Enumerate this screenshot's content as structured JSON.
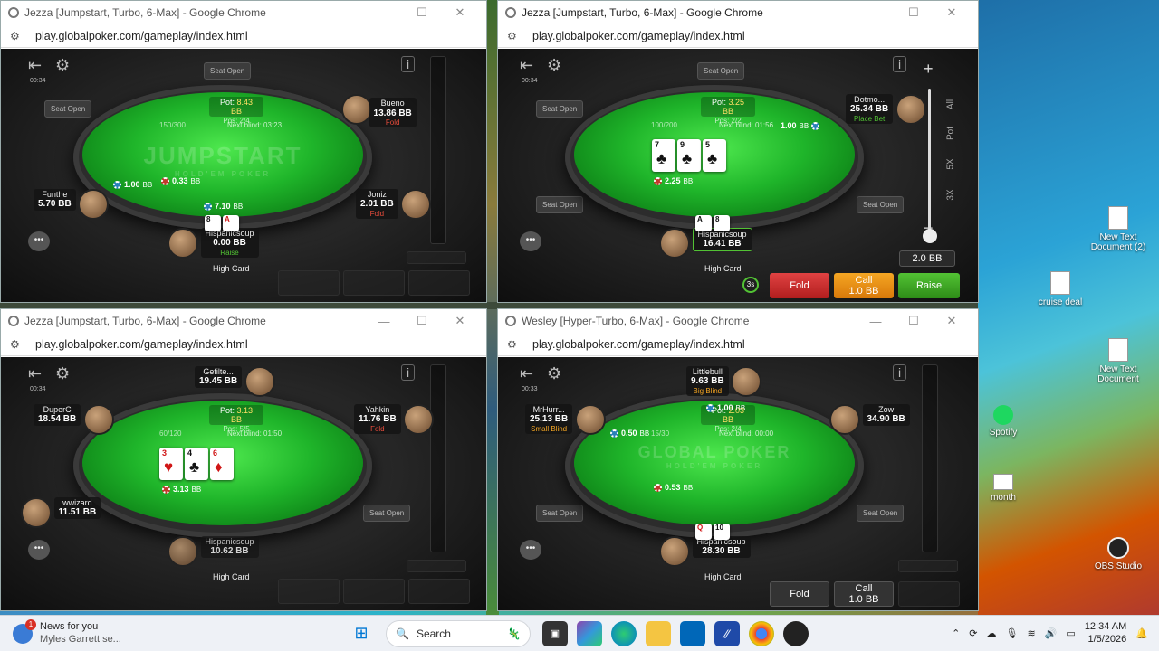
{
  "windows": [
    {
      "title": "Jezza [Jumpstart, Turbo, 6-Max] - Google Chrome",
      "url": "play.globalpoker.com/gameplay/index.html",
      "timer": "00:34",
      "pot_label": "Pot:",
      "pot": "8.43 BB",
      "pos": "Pos: 2/4",
      "blinds": "150/300",
      "next_blind": "Next blind: 03:23",
      "logo": "JUMPSTART",
      "logo_sub": "HOLD'EM POKER",
      "seat_open": "Seat Open",
      "players": [
        {
          "name": "Bueno",
          "stack": "13.86 BB",
          "action": "Fold"
        },
        {
          "name": "Funthe",
          "stack": "5.70 BB",
          "action": ""
        },
        {
          "name": "Joniz",
          "stack": "2.01 BB",
          "action": "Fold"
        },
        {
          "name": "Hispanicsoup",
          "stack": "0.00 BB",
          "action": "Raise"
        }
      ],
      "bets": [
        "1.00",
        "0.33",
        "7.10"
      ],
      "bb": "BB",
      "hole": [
        "8",
        "A"
      ],
      "hand": "High Card"
    },
    {
      "title": "Jezza [Jumpstart, Turbo, 6-Max] - Google Chrome",
      "url": "play.globalpoker.com/gameplay/index.html",
      "timer": "00:34",
      "pot_label": "Pot:",
      "pot": "3.25 BB",
      "pos": "Pos: 2/2",
      "blinds": "100/200",
      "next_blind": "Next blind: 01:56",
      "seat_open": "Seat Open",
      "players": [
        {
          "name": "Dotmo...",
          "stack": "25.34 BB",
          "action": "Place Bet"
        },
        {
          "name": "Hispanicsoup",
          "stack": "16.41 BB",
          "action": ""
        }
      ],
      "bets": [
        "1.00",
        "2.25"
      ],
      "bb": "BB",
      "board": [
        {
          "rank": "7",
          "suit": "♣"
        },
        {
          "rank": "9",
          "suit": "♣"
        },
        {
          "rank": "5",
          "suit": "♣"
        }
      ],
      "hole": [
        "A",
        "8"
      ],
      "hand": "High Card",
      "countdown": "3s",
      "fold": "Fold",
      "call": "Call",
      "call_amount": "1.0 BB",
      "raise": "Raise",
      "raise_value": "2.0 BB",
      "plus": "+",
      "minus": "−",
      "presets": [
        "All",
        "Pot",
        "5X",
        "3X"
      ]
    },
    {
      "title": "Jezza [Jumpstart, Turbo, 6-Max] - Google Chrome",
      "url": "play.globalpoker.com/gameplay/index.html",
      "timer": "00:34",
      "pot_label": "Pot:",
      "pot": "3.13 BB",
      "pos": "Pos: 5/5",
      "blinds": "60/120",
      "next_blind": "Next blind: 01:50",
      "seat_open": "Seat Open",
      "players": [
        {
          "name": "Gefilte...",
          "stack": "19.45 BB",
          "action": ""
        },
        {
          "name": "DuperC",
          "stack": "18.54 BB",
          "action": ""
        },
        {
          "name": "Yahkin",
          "stack": "11.76 BB",
          "action": "Fold"
        },
        {
          "name": "wwizard",
          "stack": "11.51 BB",
          "action": ""
        },
        {
          "name": "Hispanicsoup",
          "stack": "10.62 BB",
          "action": ""
        }
      ],
      "bets": [
        "3.13"
      ],
      "bb": "BB",
      "board": [
        {
          "rank": "3",
          "suit": "♥"
        },
        {
          "rank": "4",
          "suit": "♣"
        },
        {
          "rank": "6",
          "suit": "♦"
        }
      ],
      "hand": "High Card"
    },
    {
      "title": "Wesley [Hyper-Turbo, 6-Max] - Google Chrome",
      "url": "play.globalpoker.com/gameplay/index.html",
      "timer": "00:33",
      "pot_label": "Pot:",
      "pot": "2.03 BB",
      "pos": "Pos: 2/4",
      "blinds": "15/30",
      "next_blind": "Next blind: 00:00",
      "logo": "GLOBAL POKER",
      "logo_sub": "HOLD'EM POKER",
      "seat_open": "Seat Open",
      "players": [
        {
          "name": "Littlebull",
          "stack": "9.63 BB",
          "action": "Big Blind"
        },
        {
          "name": "MrHurr...",
          "stack": "25.13 BB",
          "action": "Small Blind"
        },
        {
          "name": "Zow",
          "stack": "34.90 BB",
          "action": ""
        },
        {
          "name": "Hispanicsoup",
          "stack": "28.30 BB",
          "action": ""
        }
      ],
      "bets": [
        "1.00",
        "0.50",
        "0.53"
      ],
      "bb": "BB",
      "hole": [
        "Q",
        "10"
      ],
      "hand": "High Card",
      "fold": "Fold",
      "call": "Call",
      "call_amount": "1.0 BB"
    }
  ],
  "desktop": {
    "icons": [
      "New Text Document (2)",
      "cruise deal",
      "New Text Document",
      "Spotify",
      "month",
      "OBS Studio"
    ]
  },
  "taskbar": {
    "news_title": "News for you",
    "news_sub": "Myles Garrett se...",
    "news_badge": "1",
    "search": "Search",
    "time": "12:34 AM",
    "date": "1/5/2026"
  }
}
